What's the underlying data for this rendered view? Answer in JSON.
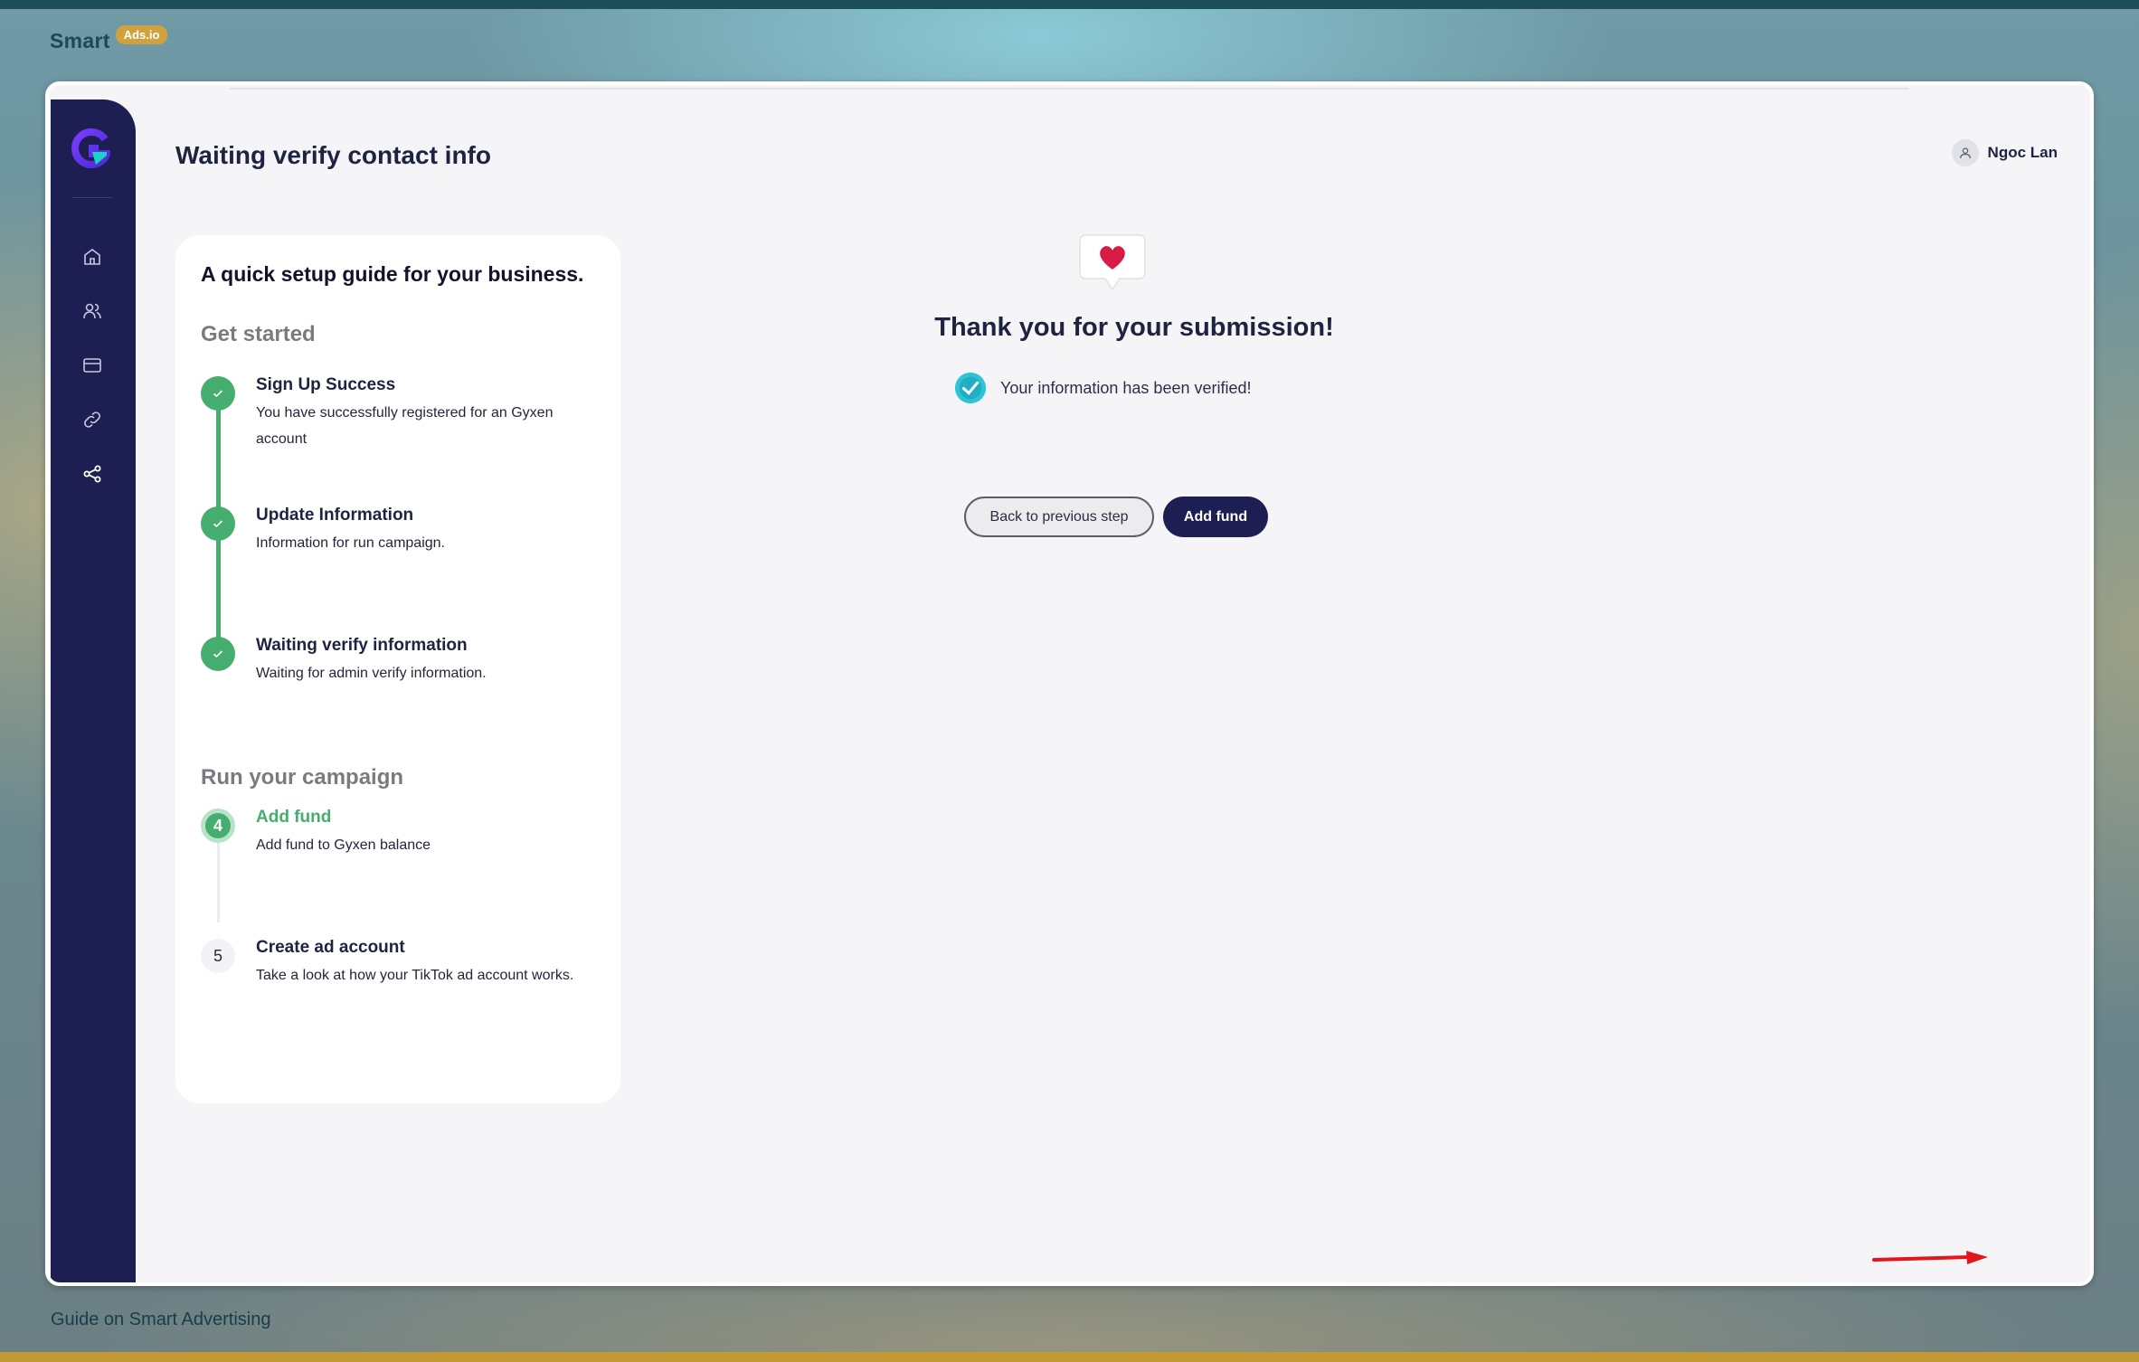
{
  "brand": {
    "name": "Smart",
    "badge": "Ads.io"
  },
  "footer": {
    "text": "Guide on Smart Advertising"
  },
  "header": {
    "title": "Waiting verify contact info",
    "user_name": "Ngoc Lan"
  },
  "sidebar": {
    "items": [
      {
        "name": "home",
        "icon": "home-icon"
      },
      {
        "name": "users",
        "icon": "users-icon"
      },
      {
        "name": "billing",
        "icon": "card-icon"
      },
      {
        "name": "links",
        "icon": "link-icon"
      },
      {
        "name": "share",
        "icon": "share-icon"
      }
    ]
  },
  "guide": {
    "heading": "A quick setup guide for your business.",
    "section_get_started": "Get started",
    "section_run_campaign": "Run your campaign",
    "steps": [
      {
        "title": "Sign Up Success",
        "desc": "You have successfully registered for an Gyxen account",
        "status": "done"
      },
      {
        "title": "Update Information",
        "desc": "Information for run campaign.",
        "status": "done"
      },
      {
        "title": "Waiting verify information",
        "desc": "Waiting for admin verify information.",
        "status": "done"
      },
      {
        "number": "4",
        "title": "Add fund",
        "desc": "Add fund to Gyxen balance",
        "status": "active"
      },
      {
        "number": "5",
        "title": "Create ad account",
        "desc": "Take a look at how your TikTok ad account works.",
        "status": "pending"
      }
    ]
  },
  "main": {
    "thanks_title": "Thank you for your submission!",
    "verified_text": "Your information has been verified!",
    "back_button": "Back to previous step",
    "add_fund_button": "Add fund"
  },
  "colors": {
    "sidebar": "#1d1f52",
    "success": "#45ad6e",
    "accent_badge": "#d1a13e",
    "messenger": "#0d86f5",
    "arrow": "#e3161b"
  }
}
